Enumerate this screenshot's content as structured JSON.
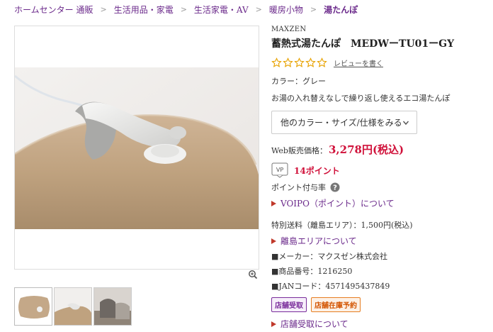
{
  "breadcrumb": {
    "items": [
      "ホームセンター 通販",
      "生活用品・家電",
      "生活家電・AV",
      "暖房小物",
      "湯たんぽ"
    ],
    "separator": ">"
  },
  "product": {
    "brand": "MAXZEN",
    "title": "蓄熱式湯たんぽ　MEDWーTU01ーGY",
    "rating_stars": 0,
    "review_link": "レビューを書く",
    "color": "カラー：グレー",
    "description": "お湯の入れ替えなしで繰り返し使えるエコ湯たんぽ",
    "variant_select": "他のカラー・サイズ/仕様をみる",
    "price_label": "Web販売価格：",
    "price_value": "3,278円(税込)",
    "points_icon": "VP",
    "points": "14ポイント",
    "point_rate_label": "ポイント付与率",
    "voipo_link": "VOIPO（ポイント）について",
    "shipping": "特別送料（離島エリア）：1,500円(税込)",
    "island_link": "離島エリアについて",
    "maker": "■メーカー：マクスゼン株式会社",
    "product_number": "■商品番号：1216250",
    "jan": "■JANコード：4571495437849",
    "badges": [
      "店舗受取",
      "店舗在庫予約"
    ],
    "store_link": "店舗受取について"
  },
  "colors": {
    "link_purple": "#6b2a8b",
    "price_red": "#d0113a",
    "star_gold": "#e8a200",
    "badge_orange": "#e67e22"
  },
  "icons": {
    "zoom": "zoom-icon",
    "help": "help-icon",
    "star": "star-outline-icon"
  }
}
